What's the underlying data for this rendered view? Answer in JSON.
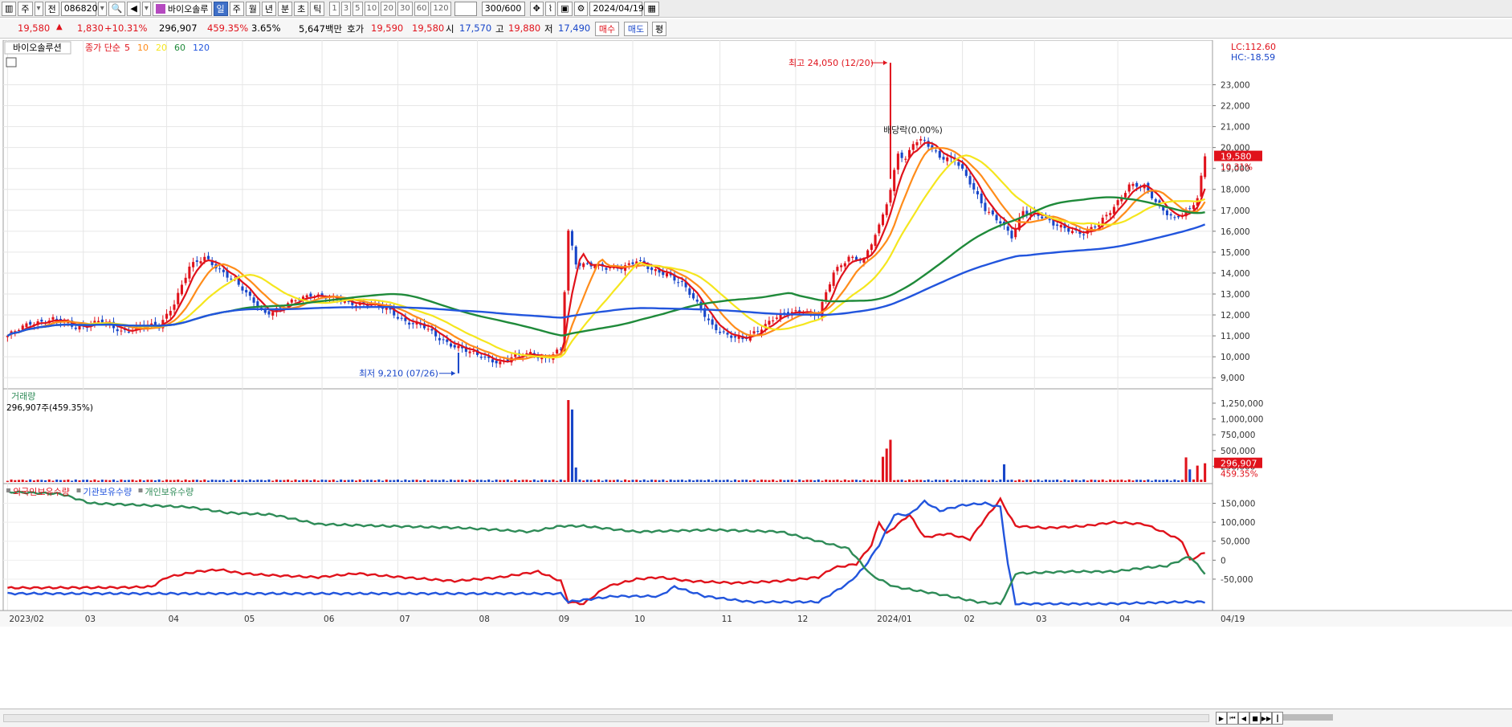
{
  "toolbar": {
    "market_label": "주",
    "code_prefix": "전",
    "stock_code": "086820",
    "stock_name": "바이오솔루",
    "periods": [
      "일",
      "주",
      "월",
      "년",
      "분",
      "초",
      "틱"
    ],
    "active_period": "일",
    "counts": [
      "1",
      "3",
      "5",
      "10",
      "20",
      "30",
      "60",
      "120"
    ],
    "range": "300/600",
    "date": "2024/04/19"
  },
  "quote": {
    "price": "19,580",
    "change": "1,830",
    "change_pct": "+10.31%",
    "volume": "296,907",
    "volume_pct": "459.35%",
    "turnover_pct": "3.65%",
    "amount": "5,647백만",
    "ask_label": "호가",
    "ask1": "19,590",
    "bid1": "19,580",
    "open_label": "시",
    "open": "17,570",
    "high_label": "고",
    "high": "19,880",
    "low_label": "저",
    "low": "17,490",
    "buy_btn": "매수",
    "sell_btn": "매도",
    "eval_btn": "평"
  },
  "colors": {
    "up": "#e0121b",
    "down": "#1846c9",
    "ma5": "#e0121b",
    "ma10": "#ff8c1a",
    "ma20": "#f5e61e",
    "ma60": "#1f8a3a",
    "ma120": "#2255dd",
    "foreign": "#e0121b",
    "institution": "#2255dd",
    "individual": "#2e8b57"
  },
  "chart_data": [
    {
      "type": "candlestick",
      "title": "바이오솔루션",
      "legend": {
        "label": "종가 단순",
        "periods": [
          "5",
          "10",
          "20",
          "60",
          "120"
        ]
      },
      "x_ticks": [
        "2023/02",
        "03",
        "04",
        "05",
        "06",
        "07",
        "08",
        "09",
        "10",
        "11",
        "12",
        "2024/01",
        "02",
        "03",
        "04"
      ],
      "x_end_label": "04/19",
      "y_ticks": [
        "9,000",
        "10,000",
        "11,000",
        "12,000",
        "13,000",
        "14,000",
        "15,000",
        "16,000",
        "17,000",
        "18,000",
        "19,000",
        "20,000",
        "21,000",
        "22,000",
        "23,000"
      ],
      "ylim": [
        8700,
        24900
      ],
      "lc": "LC:112.60",
      "hc": "HC:-18.59",
      "last_price": "19,580",
      "last_pct": "10.31%",
      "annotations": {
        "high": "최고 24,050 (12/20)",
        "low": "최저 9,210 (07/26)",
        "dividend": "배당락(0.00%)"
      },
      "close_anchors": [
        [
          0,
          11000
        ],
        [
          6,
          11600
        ],
        [
          12,
          11800
        ],
        [
          18,
          11400
        ],
        [
          24,
          11700
        ],
        [
          30,
          11200
        ],
        [
          36,
          11500
        ],
        [
          40,
          11400
        ],
        [
          44,
          12600
        ],
        [
          48,
          14300
        ],
        [
          52,
          14700
        ],
        [
          56,
          14200
        ],
        [
          60,
          13600
        ],
        [
          64,
          12800
        ],
        [
          68,
          12100
        ],
        [
          72,
          12300
        ],
        [
          76,
          12700
        ],
        [
          80,
          13000
        ],
        [
          85,
          12800
        ],
        [
          90,
          12600
        ],
        [
          95,
          12500
        ],
        [
          100,
          12300
        ],
        [
          105,
          11700
        ],
        [
          110,
          11400
        ],
        [
          114,
          10900
        ],
        [
          118,
          10500
        ],
        [
          122,
          10200
        ],
        [
          126,
          10000
        ],
        [
          130,
          9700
        ],
        [
          134,
          10000
        ],
        [
          138,
          10200
        ],
        [
          142,
          9900
        ],
        [
          146,
          10300
        ],
        [
          148,
          16000
        ],
        [
          150,
          14500
        ],
        [
          154,
          14400
        ],
        [
          158,
          14200
        ],
        [
          162,
          14300
        ],
        [
          166,
          14600
        ],
        [
          170,
          14100
        ],
        [
          174,
          14000
        ],
        [
          178,
          13500
        ],
        [
          182,
          12500
        ],
        [
          186,
          11500
        ],
        [
          190,
          11000
        ],
        [
          194,
          10800
        ],
        [
          198,
          11300
        ],
        [
          202,
          11800
        ],
        [
          206,
          12100
        ],
        [
          210,
          12200
        ],
        [
          214,
          12000
        ],
        [
          218,
          14000
        ],
        [
          222,
          14800
        ],
        [
          226,
          14600
        ],
        [
          230,
          16200
        ],
        [
          233,
          18000
        ],
        [
          235,
          19800
        ],
        [
          237,
          19400
        ],
        [
          239,
          20200
        ],
        [
          242,
          20300
        ],
        [
          246,
          19600
        ],
        [
          250,
          19400
        ],
        [
          254,
          18300
        ],
        [
          258,
          17100
        ],
        [
          262,
          16400
        ],
        [
          265,
          15700
        ],
        [
          268,
          17000
        ],
        [
          272,
          16800
        ],
        [
          276,
          16300
        ],
        [
          280,
          16100
        ],
        [
          284,
          15900
        ],
        [
          288,
          16300
        ],
        [
          292,
          17200
        ],
        [
          296,
          18200
        ],
        [
          300,
          18100
        ],
        [
          304,
          17200
        ],
        [
          308,
          16600
        ],
        [
          312,
          17000
        ],
        [
          314,
          17600
        ],
        [
          316,
          19580
        ]
      ]
    },
    {
      "type": "bar",
      "title": "거래량",
      "subtitle": "296,907주(459.35%)",
      "y_ticks": [
        "250,000",
        "500,000",
        "750,000",
        "1,000,000",
        "1,250,000"
      ],
      "ylim": [
        0,
        1300000
      ],
      "last_value": "296,907",
      "last_pct": "459.35%",
      "spikes": [
        [
          148,
          1300000
        ],
        [
          149,
          1150000
        ],
        [
          150,
          230000
        ],
        [
          231,
          400000
        ],
        [
          232,
          530000
        ],
        [
          233,
          670000
        ],
        [
          263,
          280000
        ],
        [
          311,
          390000
        ],
        [
          312,
          200000
        ],
        [
          314,
          260000
        ],
        [
          316,
          297000
        ]
      ]
    },
    {
      "type": "line",
      "series": [
        {
          "name": "외국인보유수량",
          "values": [
            [
              0,
              -73000
            ],
            [
              30,
              -72000
            ],
            [
              38,
              -70000
            ],
            [
              42,
              -45000
            ],
            [
              50,
              -30000
            ],
            [
              56,
              -25000
            ],
            [
              62,
              -35000
            ],
            [
              70,
              -40000
            ],
            [
              82,
              -45000
            ],
            [
              92,
              -35000
            ],
            [
              104,
              -45000
            ],
            [
              118,
              -55000
            ],
            [
              130,
              -45000
            ],
            [
              140,
              -30000
            ],
            [
              146,
              -55000
            ],
            [
              148,
              -110000
            ],
            [
              152,
              -115000
            ],
            [
              158,
              -70000
            ],
            [
              166,
              -50000
            ],
            [
              172,
              -45000
            ],
            [
              180,
              -55000
            ],
            [
              192,
              -60000
            ],
            [
              204,
              -55000
            ],
            [
              214,
              -45000
            ],
            [
              218,
              -20000
            ],
            [
              224,
              -10000
            ],
            [
              228,
              40000
            ],
            [
              230,
              100000
            ],
            [
              232,
              70000
            ],
            [
              238,
              120000
            ],
            [
              242,
              60000
            ],
            [
              248,
              70000
            ],
            [
              254,
              55000
            ],
            [
              258,
              110000
            ],
            [
              262,
              160000
            ],
            [
              266,
              90000
            ],
            [
              274,
              85000
            ],
            [
              284,
              90000
            ],
            [
              292,
              100000
            ],
            [
              300,
              95000
            ],
            [
              306,
              70000
            ],
            [
              310,
              50000
            ],
            [
              312,
              0
            ],
            [
              316,
              20000
            ]
          ]
        },
        {
          "name": "기관보유수량",
          "values": [
            [
              0,
              -88000
            ],
            [
              50,
              -88000
            ],
            [
              100,
              -88000
            ],
            [
              146,
              -88000
            ],
            [
              148,
              -110000
            ],
            [
              160,
              -95000
            ],
            [
              172,
              -95000
            ],
            [
              176,
              -70000
            ],
            [
              184,
              -95000
            ],
            [
              196,
              -110000
            ],
            [
              214,
              -110000
            ],
            [
              222,
              -60000
            ],
            [
              226,
              -20000
            ],
            [
              230,
              40000
            ],
            [
              234,
              120000
            ],
            [
              238,
              120000
            ],
            [
              242,
              155000
            ],
            [
              246,
              130000
            ],
            [
              252,
              145000
            ],
            [
              258,
              150000
            ],
            [
              262,
              140000
            ],
            [
              264,
              -10000
            ],
            [
              266,
              -115000
            ],
            [
              290,
              -115000
            ],
            [
              310,
              -110000
            ],
            [
              316,
              -110000
            ]
          ]
        },
        {
          "name": "개인보유수량",
          "values": [
            [
              0,
              180000
            ],
            [
              14,
              175000
            ],
            [
              22,
              150000
            ],
            [
              36,
              145000
            ],
            [
              48,
              140000
            ],
            [
              58,
              125000
            ],
            [
              70,
              120000
            ],
            [
              82,
              95000
            ],
            [
              100,
              90000
            ],
            [
              120,
              85000
            ],
            [
              138,
              75000
            ],
            [
              146,
              90000
            ],
            [
              152,
              90000
            ],
            [
              166,
              75000
            ],
            [
              186,
              80000
            ],
            [
              204,
              75000
            ],
            [
              214,
              50000
            ],
            [
              222,
              30000
            ],
            [
              228,
              -40000
            ],
            [
              234,
              -70000
            ],
            [
              246,
              -90000
            ],
            [
              256,
              -110000
            ],
            [
              262,
              -115000
            ],
            [
              264,
              -80000
            ],
            [
              266,
              -35000
            ],
            [
              280,
              -30000
            ],
            [
              292,
              -30000
            ],
            [
              300,
              -20000
            ],
            [
              306,
              -15000
            ],
            [
              312,
              10000
            ],
            [
              316,
              -35000
            ]
          ]
        }
      ],
      "y_ticks": [
        "-50,000",
        "0",
        "50,000",
        "100,000",
        "150,000"
      ],
      "ylim": [
        -120000,
        185000
      ]
    }
  ],
  "footer": {
    "nav": [
      "▶",
      "⏮",
      "◀",
      "■",
      "▶▶",
      "┃"
    ]
  }
}
